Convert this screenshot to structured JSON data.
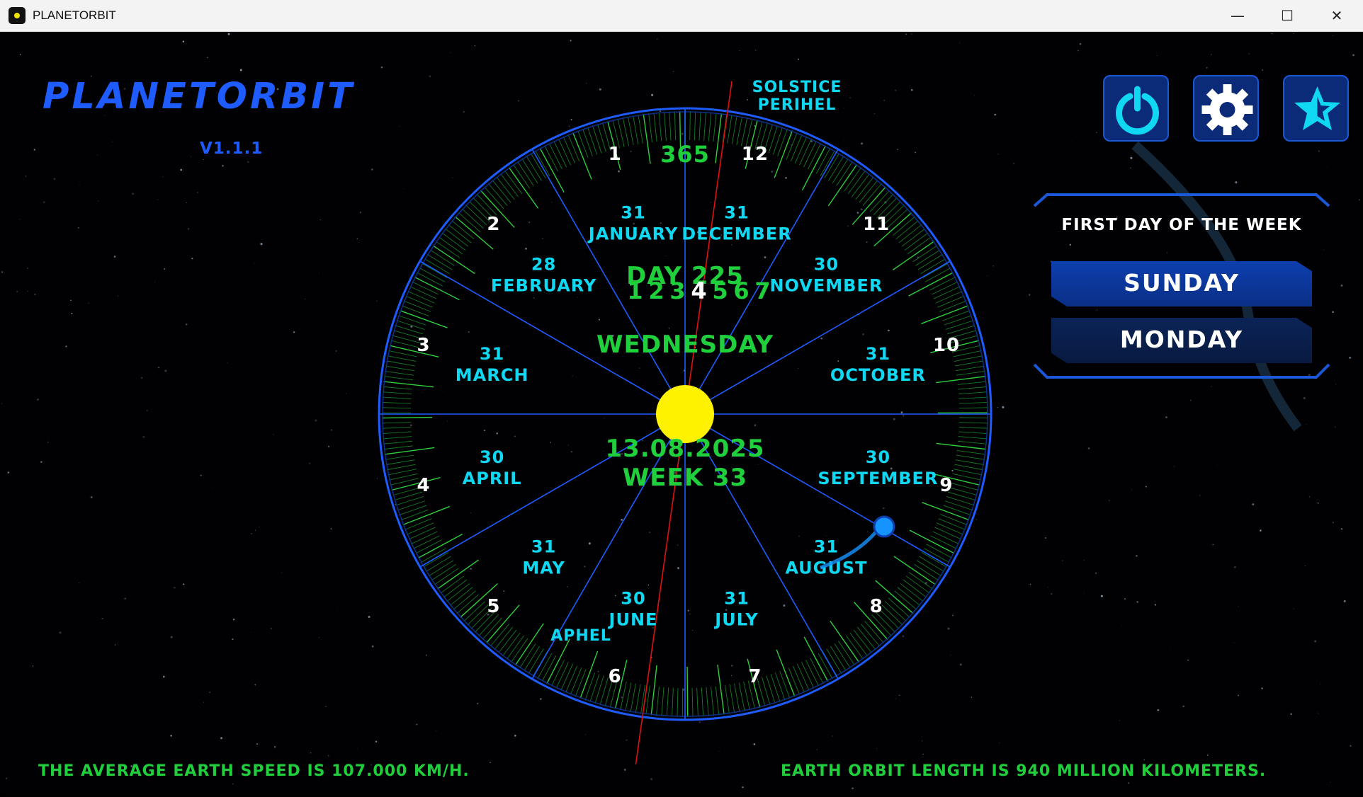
{
  "window": {
    "title": "PLANETORBIT",
    "minimize_glyph": "—",
    "maximize_glyph": "☐",
    "close_glyph": "✕"
  },
  "app": {
    "name": "PLANETORBIT",
    "version": "V1.1.1"
  },
  "toolbar": {
    "buttons": [
      {
        "name": "power-button",
        "icon": "power-icon"
      },
      {
        "name": "settings-button",
        "icon": "gear-icon"
      },
      {
        "name": "favorite-button",
        "icon": "star-icon"
      }
    ]
  },
  "orbit": {
    "solstice_label": "SOLSTICE",
    "perihel_label": "PERIHEL",
    "aphel_label": "APHEL",
    "total_days": "365",
    "day_label": "DAY 225",
    "weekdays": [
      "1",
      "2",
      "3",
      "4",
      "5",
      "6",
      "7"
    ],
    "current_weekday_index": 3,
    "weekday_name": "WEDNESDAY",
    "date": "13.08.2025",
    "week_label": "WEEK 33",
    "month_numbers": [
      "1",
      "2",
      "3",
      "4",
      "5",
      "6",
      "7",
      "8",
      "9",
      "10",
      "11",
      "12"
    ],
    "months": [
      {
        "name": "JANUARY",
        "days": "31"
      },
      {
        "name": "FEBRUARY",
        "days": "28"
      },
      {
        "name": "MARCH",
        "days": "31"
      },
      {
        "name": "APRIL",
        "days": "30"
      },
      {
        "name": "MAY",
        "days": "31"
      },
      {
        "name": "JUNE",
        "days": "30"
      },
      {
        "name": "JULY",
        "days": "31"
      },
      {
        "name": "AUGUST",
        "days": "31"
      },
      {
        "name": "SEPTEMBER",
        "days": "30"
      },
      {
        "name": "OCTOBER",
        "days": "31"
      },
      {
        "name": "NOVEMBER",
        "days": "30"
      },
      {
        "name": "DECEMBER",
        "days": "31"
      }
    ]
  },
  "week_panel": {
    "title": "FIRST DAY OF THE WEEK",
    "options": [
      "SUNDAY",
      "MONDAY"
    ],
    "selected": "SUNDAY"
  },
  "footer": {
    "speed_text": "THE AVERAGE EARTH SPEED IS 107.000 KM/H.",
    "orbit_text": "EARTH ORBIT LENGTH IS 940 MILLION KILOMETERS."
  },
  "colors": {
    "accent_blue": "#1e5cff",
    "cyan": "#10d8f2",
    "green": "#1fcf3b",
    "sun": "#fff200",
    "earth": "#1593ff",
    "axis_red": "#e01010"
  }
}
